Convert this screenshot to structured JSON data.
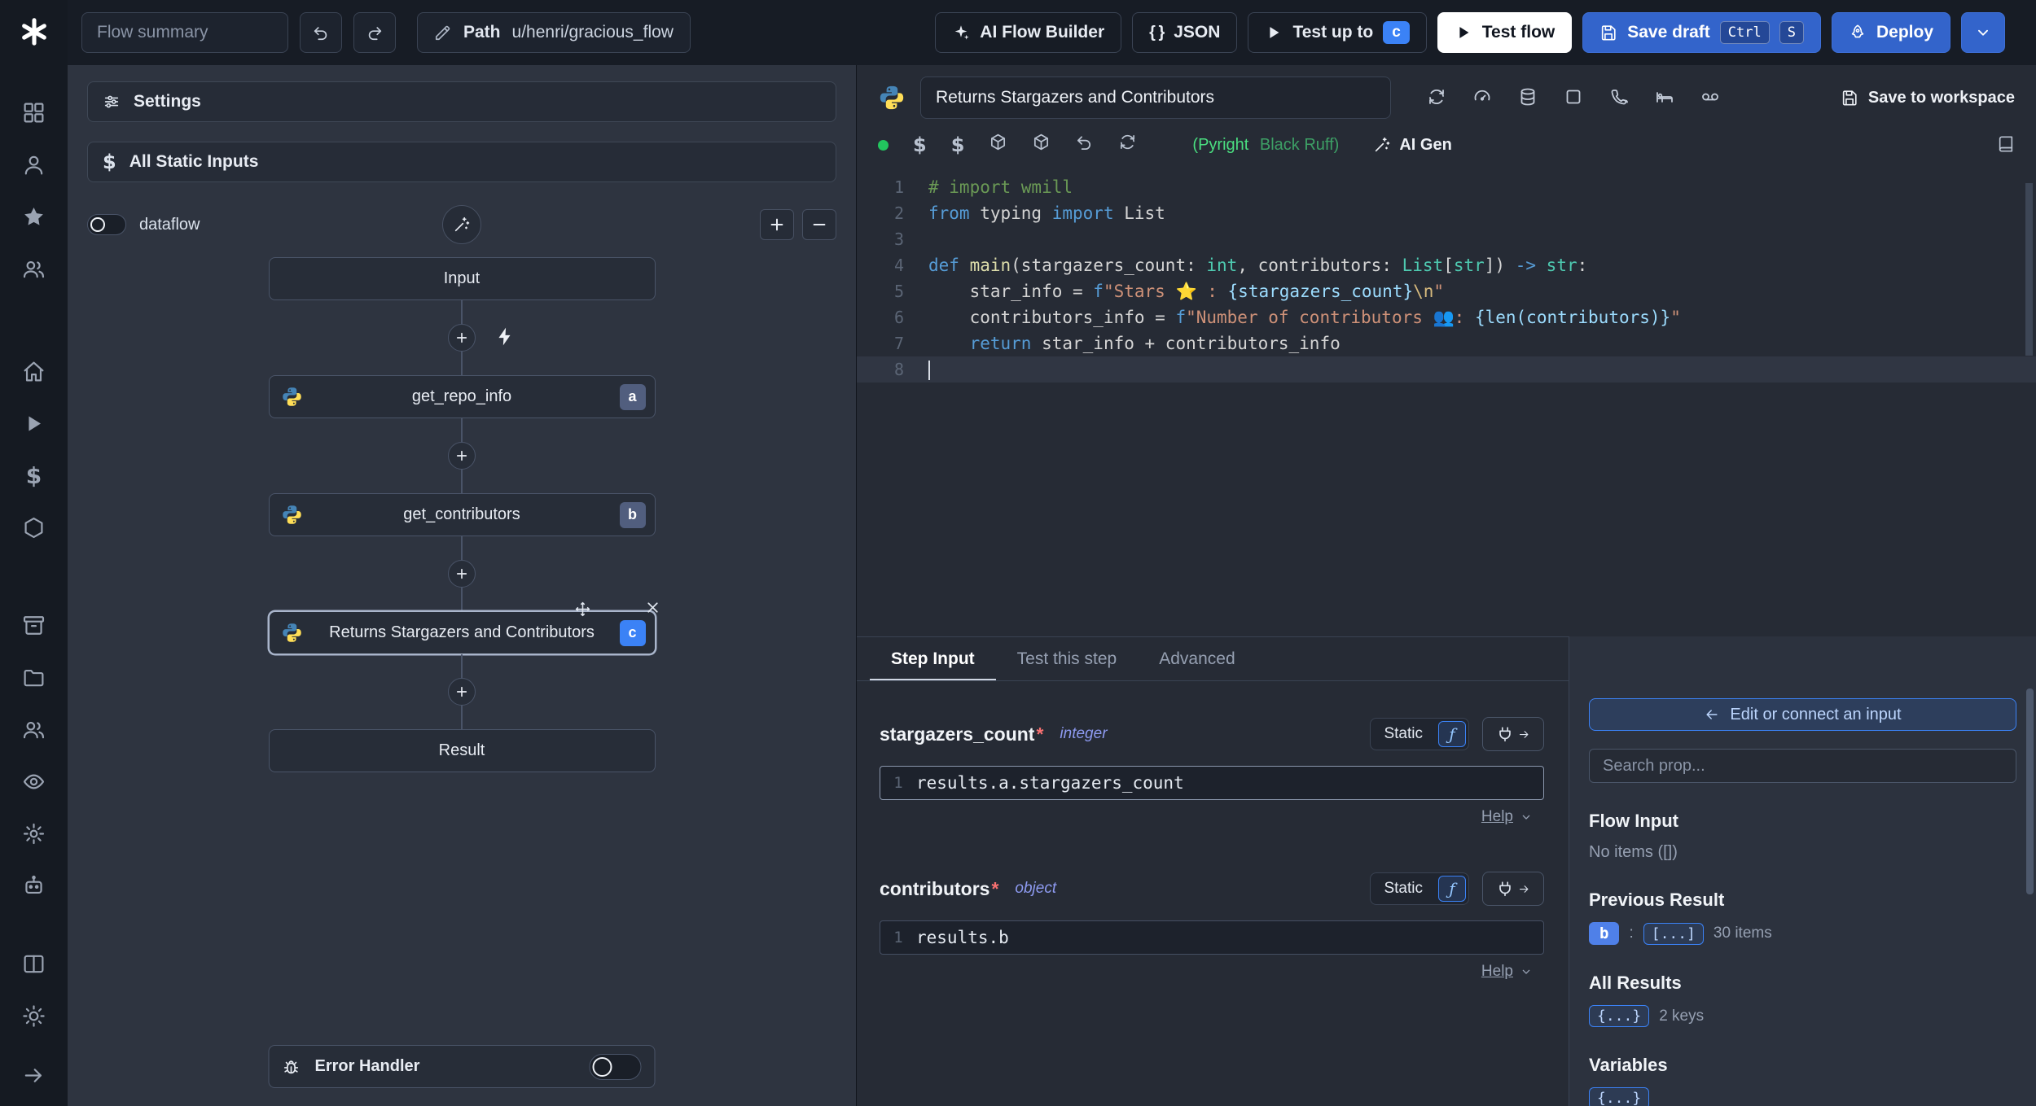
{
  "topbar": {
    "flow_summary_placeholder": "Flow summary",
    "path_label": "Path",
    "path_value": "u/henri/gracious_flow",
    "ai_flow_builder_label": "AI Flow Builder",
    "json_label": "JSON",
    "test_up_to_label": "Test up to",
    "test_up_to_badge": "c",
    "test_flow_label": "Test flow",
    "save_draft_label": "Save draft",
    "save_draft_kbd": [
      "Ctrl",
      "S"
    ],
    "deploy_label": "Deploy"
  },
  "sidebar": {
    "groups": [
      [
        "grid",
        "user",
        "star",
        "users"
      ],
      [
        "home",
        "play",
        "dollar",
        "hexagon"
      ],
      [
        "archive",
        "folder",
        "users2",
        "eye",
        "gear",
        "bot"
      ],
      [
        "columns",
        "sun"
      ]
    ]
  },
  "flow": {
    "settings_label": "Settings",
    "static_inputs_label": "All Static Inputs",
    "dataflow_label": "dataflow",
    "nodes": [
      {
        "label": "Input"
      },
      {
        "label": "get_repo_info",
        "badge": "a"
      },
      {
        "label": "get_contributors",
        "badge": "b"
      },
      {
        "label": "Returns Stargazers and Contributors",
        "badge": "c"
      },
      {
        "label": "Result"
      }
    ],
    "error_handler_label": "Error Handler"
  },
  "editor": {
    "title": "Returns Stargazers and Contributors",
    "save_to_workspace_label": "Save to workspace",
    "assistants_primary": "(Pyright",
    "assistants_secondary": "Black Ruff)",
    "ai_gen_label": "AI Gen",
    "active_line": 8,
    "lines": [
      {
        "segs": [
          [
            "c",
            "# import wmill"
          ]
        ]
      },
      {
        "segs": [
          [
            "k",
            "from"
          ],
          [
            "p",
            " typing "
          ],
          [
            "k",
            "import"
          ],
          [
            "p",
            " List"
          ]
        ]
      },
      {
        "segs": []
      },
      {
        "segs": [
          [
            "k",
            "def"
          ],
          [
            "fn",
            " main"
          ],
          [
            "p",
            "(stargazers_count: "
          ],
          [
            "t",
            "int"
          ],
          [
            "p",
            ", contributors: "
          ],
          [
            "t",
            "List"
          ],
          [
            "p",
            "["
          ],
          [
            "t",
            "str"
          ],
          [
            "p",
            "]) "
          ],
          [
            "k",
            "->"
          ],
          [
            "p",
            " "
          ],
          [
            "t",
            "str"
          ],
          [
            "p",
            ":"
          ]
        ]
      },
      {
        "segs": [
          [
            "p",
            "    star_info = "
          ],
          [
            "k",
            "f"
          ],
          [
            "s",
            "\"Stars ⭐ : "
          ],
          [
            "i",
            "{stargazers_count}"
          ],
          [
            "e",
            "\\n"
          ],
          [
            "s",
            "\""
          ]
        ]
      },
      {
        "segs": [
          [
            "p",
            "    contributors_info = "
          ],
          [
            "k",
            "f"
          ],
          [
            "s",
            "\"Number of contributors 👥: "
          ],
          [
            "i",
            "{len(contributors)}"
          ],
          [
            "s",
            "\""
          ]
        ]
      },
      {
        "segs": [
          [
            "p",
            "    "
          ],
          [
            "k",
            "return"
          ],
          [
            "p",
            " star_info + contributors_info"
          ]
        ]
      },
      {
        "segs": []
      }
    ]
  },
  "step": {
    "tabs": [
      {
        "label": "Step Input"
      },
      {
        "label": "Test this step"
      },
      {
        "label": "Advanced"
      }
    ],
    "fields": [
      {
        "name": "stargazers_count",
        "required": "*",
        "type": "integer",
        "mode": "Static",
        "line_no": "1",
        "expr": "results.a.stargazers_count",
        "help_label": "Help"
      },
      {
        "name": "contributors",
        "required": "*",
        "type": "object",
        "mode": "Static",
        "line_no": "1",
        "expr": "results.b",
        "help_label": "Help"
      }
    ]
  },
  "connect": {
    "edit_button_label": "Edit or connect an input",
    "search_placeholder": "Search prop...",
    "flow_input_title": "Flow Input",
    "flow_input_empty": "No items ([])",
    "previous_result_title": "Previous Result",
    "previous_result_badge": "b",
    "previous_result_colon": ":",
    "previous_result_collapsed": "[...]",
    "previous_result_count": "30 items",
    "all_results_title": "All Results",
    "all_results_collapsed": "{...}",
    "all_results_count": "2 keys",
    "variables_title": "Variables",
    "variables_collapsed": "{...}"
  },
  "colors": {
    "accent_blue": "#3b82f6",
    "button_blue": "#3364cb",
    "status_green": "#22c55e",
    "badge_slate": "#515e7e",
    "panel_bg": "#2e3440",
    "editor_bg": "#262b35"
  }
}
